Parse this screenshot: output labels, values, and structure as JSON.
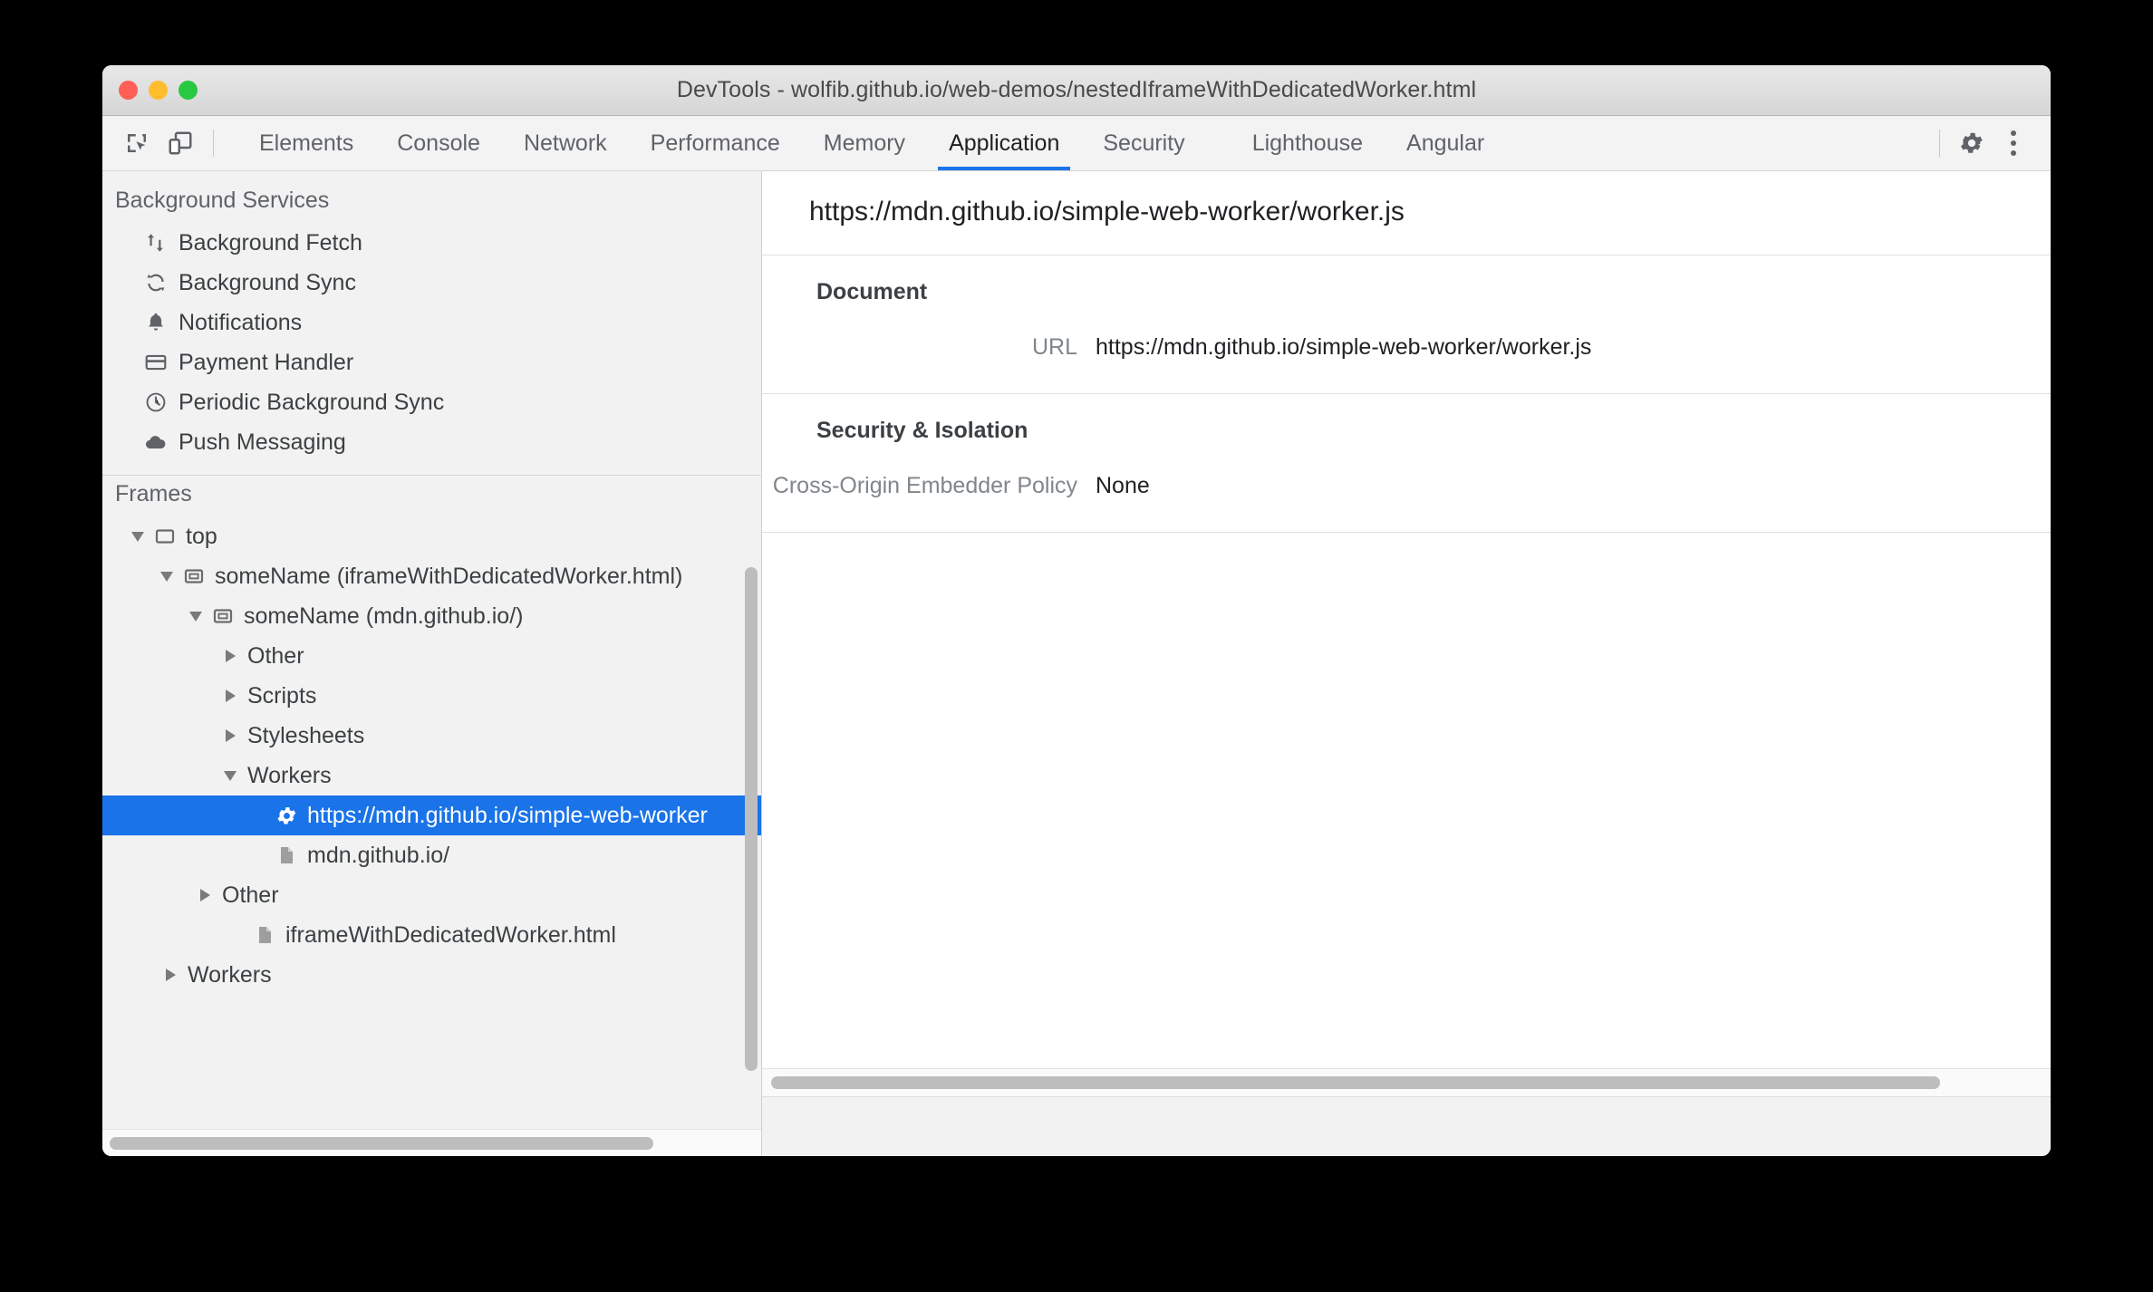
{
  "window": {
    "title": "DevTools - wolfib.github.io/web-demos/nestedIframeWithDedicatedWorker.html"
  },
  "toolbar": {
    "inspect_icon": "inspect-element-icon",
    "device_icon": "device-toolbar-icon",
    "settings_icon": "gear-icon",
    "more_icon": "more-options-icon",
    "tabs": [
      {
        "label": "Elements",
        "active": false
      },
      {
        "label": "Console",
        "active": false
      },
      {
        "label": "Network",
        "active": false
      },
      {
        "label": "Performance",
        "active": false
      },
      {
        "label": "Memory",
        "active": false
      },
      {
        "label": "Application",
        "active": true
      },
      {
        "label": "Security",
        "active": false
      },
      {
        "label": "Lighthouse",
        "active": false
      },
      {
        "label": "Angular",
        "active": false
      }
    ]
  },
  "sidebar": {
    "background_services": {
      "title": "Background Services",
      "items": [
        {
          "label": "Background Fetch",
          "icon": "arrows-up-down-icon"
        },
        {
          "label": "Background Sync",
          "icon": "sync-icon"
        },
        {
          "label": "Notifications",
          "icon": "bell-icon"
        },
        {
          "label": "Payment Handler",
          "icon": "credit-card-icon"
        },
        {
          "label": "Periodic Background Sync",
          "icon": "clock-icon"
        },
        {
          "label": "Push Messaging",
          "icon": "cloud-icon"
        }
      ]
    },
    "frames": {
      "title": "Frames",
      "tree": [
        {
          "label": "top",
          "indent": 1,
          "twisty": "open",
          "icon": "frame-top-icon",
          "selected": false
        },
        {
          "label": "someName (iframeWithDedicatedWorker.html)",
          "indent": 2,
          "twisty": "open",
          "icon": "iframe-icon",
          "selected": false
        },
        {
          "label": "someName (mdn.github.io/)",
          "indent": 3,
          "twisty": "open",
          "icon": "iframe-icon",
          "selected": false
        },
        {
          "label": "Other",
          "indent": 4,
          "twisty": "closed",
          "icon": "none",
          "selected": false
        },
        {
          "label": "Scripts",
          "indent": 4,
          "twisty": "closed",
          "icon": "none",
          "selected": false
        },
        {
          "label": "Stylesheets",
          "indent": 4,
          "twisty": "closed",
          "icon": "none",
          "selected": false
        },
        {
          "label": "Workers",
          "indent": 4,
          "twisty": "open",
          "icon": "none",
          "selected": false
        },
        {
          "label": "https://mdn.github.io/simple-web-worker",
          "indent": 5,
          "twisty": "none",
          "icon": "worker-gear-icon",
          "selected": true
        },
        {
          "label": "mdn.github.io/",
          "indent": 5,
          "twisty": "none",
          "icon": "document-icon",
          "selected": false
        },
        {
          "label": "Other",
          "indent": 3,
          "twisty": "closed",
          "icon": "none",
          "selected": false
        },
        {
          "label": "iframeWithDedicatedWorker.html",
          "indent": 4,
          "twisty": "none",
          "icon": "document-icon",
          "selected": false
        },
        {
          "label": "Workers",
          "indent": 2,
          "twisty": "closed",
          "icon": "none",
          "selected": false
        }
      ]
    }
  },
  "main": {
    "panel_title": "https://mdn.github.io/simple-web-worker/worker.js",
    "sections": [
      {
        "heading": "Document",
        "fields": [
          {
            "name": "URL",
            "value": "https://mdn.github.io/simple-web-worker/worker.js"
          }
        ]
      },
      {
        "heading": "Security & Isolation",
        "fields": [
          {
            "name": "Cross-Origin Embedder Policy",
            "value": "None"
          }
        ]
      }
    ]
  },
  "colors": {
    "accent": "#1a73e8",
    "selected_row_bg": "#1a73e8",
    "sidebar_bg": "#f2f2f2",
    "panel_bg": "#ffffff",
    "text_primary": "#202124",
    "text_secondary": "#80868b",
    "scrollbar": "#bdbdbd",
    "traffic_close": "#ff5f56",
    "traffic_min": "#ffbd2e",
    "traffic_max": "#28c840"
  }
}
